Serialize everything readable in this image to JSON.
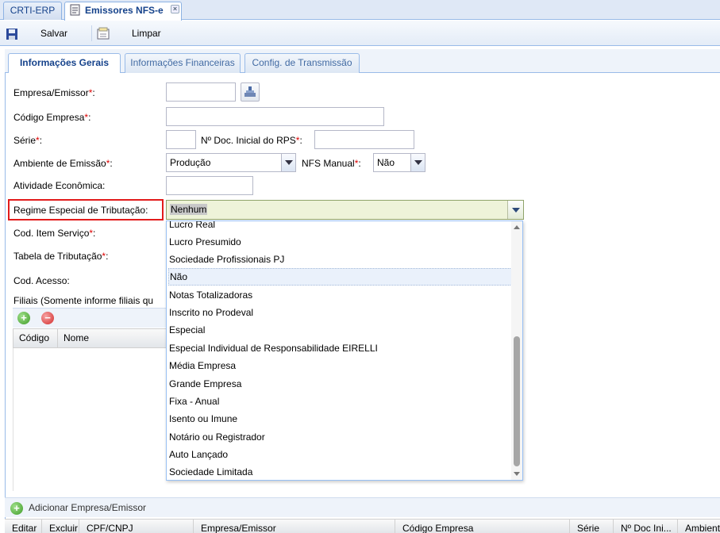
{
  "top_tabs": [
    {
      "label": "CRTI-ERP"
    },
    {
      "label": "Emissores NFS-e"
    }
  ],
  "toolbar": {
    "save_label": "Salvar",
    "clear_label": "Limpar"
  },
  "inner_tabs": [
    {
      "label": "Informações Gerais",
      "active": true
    },
    {
      "label": "Informações Financeiras"
    },
    {
      "label": "Config. de Transmissão"
    }
  ],
  "form": {
    "empresa_label": "Empresa/Emissor",
    "codigo_empresa_label": "Código Empresa",
    "serie_label": "Série",
    "doc_inicial_label": "Nº Doc. Inicial do RPS",
    "ambiente_label": "Ambiente de Emissão",
    "ambiente_value": "Produção",
    "nfs_manual_label": "NFS Manual",
    "nfs_manual_value": "Não",
    "atividade_label": "Atividade Econômica:",
    "regime_label": "Regime Especial de Tributação:",
    "regime_value": "Nenhum",
    "cod_item_label": "Cod. Item Serviço",
    "tabela_label": "Tabela de Tributação",
    "cod_acesso_label": "Cod. Acesso:",
    "filiais_label": "Filiais (Somente informe filiais qu",
    "required_mark": "*",
    "colon": ":"
  },
  "filiais_grid": {
    "columns": [
      "Código",
      "Nome"
    ]
  },
  "dropdown": {
    "options": [
      "Lucro Real",
      "Lucro Presumido",
      "Sociedade Profissionais PJ",
      "Não",
      "Notas Totalizadoras",
      "Inscrito no Prodeval",
      "Especial",
      "Especial Individual de Responsabilidade EIRELLI",
      "Média Empresa",
      "Grande Empresa",
      "Fixa - Anual",
      "Isento ou Imune",
      "Notário ou Registrador",
      "Auto Lançado",
      "Sociedade Limitada"
    ],
    "selected": "Não"
  },
  "bottom": {
    "add_label": "Adicionar Empresa/Emissor",
    "columns": [
      "Editar",
      "Excluir",
      "CPF/CNPJ",
      "Empresa/Emissor",
      "Código Empresa",
      "Série",
      "Nº Doc Ini...",
      "Ambient"
    ]
  },
  "colors": {
    "accent": "#15428b",
    "required": "#dd0000",
    "highlight": "#e21b1b"
  }
}
